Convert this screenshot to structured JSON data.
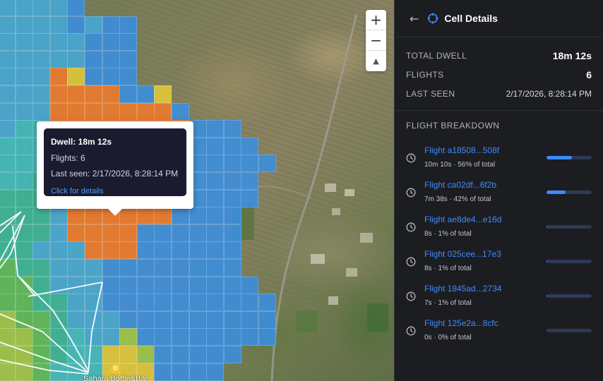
{
  "map": {
    "zoom_in_label": "+",
    "zoom_out_label": "−",
    "compass_label": "▲",
    "poi_label": "Sahara Bottle&Bar",
    "poi_icon": "restaurant-icon",
    "heat_colors": {
      "blue": "#3a8fe0",
      "lightblue": "#45a9d8",
      "cyan": "#3fbcc1",
      "teal": "#39b69a",
      "green": "#5bbb5a",
      "lime": "#9fc749",
      "yellow": "#e2c93b",
      "orange": "#f07a2c"
    }
  },
  "tooltip": {
    "title": "Dwell: 18m 12s",
    "flights": "Flights: 6",
    "last_seen": "Last seen: 2/17/2026, 8:28:14 PM",
    "link": "Click for details"
  },
  "panel": {
    "back_icon": "arrow-left-icon",
    "title_icon": "crosshair-icon",
    "title": "Cell Details",
    "summary": [
      {
        "label": "TOTAL DWELL",
        "value": "18m 12s"
      },
      {
        "label": "FLIGHTS",
        "value": "6"
      },
      {
        "label": "LAST SEEN",
        "value": "2/17/2026, 8:28:14 PM"
      }
    ],
    "breakdown_title": "FLIGHT BREAKDOWN",
    "flights": [
      {
        "name": "Flight a18508...508f",
        "meta": "10m 10s · 56% of total",
        "share": 0.56
      },
      {
        "name": "Flight ca02df...6f2b",
        "meta": "7m 38s · 42% of total",
        "share": 0.42
      },
      {
        "name": "Flight ae8de4...e16d",
        "meta": "8s · 1% of total",
        "share": 0.01
      },
      {
        "name": "Flight 025cee...17e3",
        "meta": "8s · 1% of total",
        "share": 0.01
      },
      {
        "name": "Flight 1845ad...2734",
        "meta": "7s · 1% of total",
        "share": 0.01
      },
      {
        "name": "Flight 125e2a...8cfc",
        "meta": "0s · 0% of total",
        "share": 0.0
      }
    ]
  }
}
